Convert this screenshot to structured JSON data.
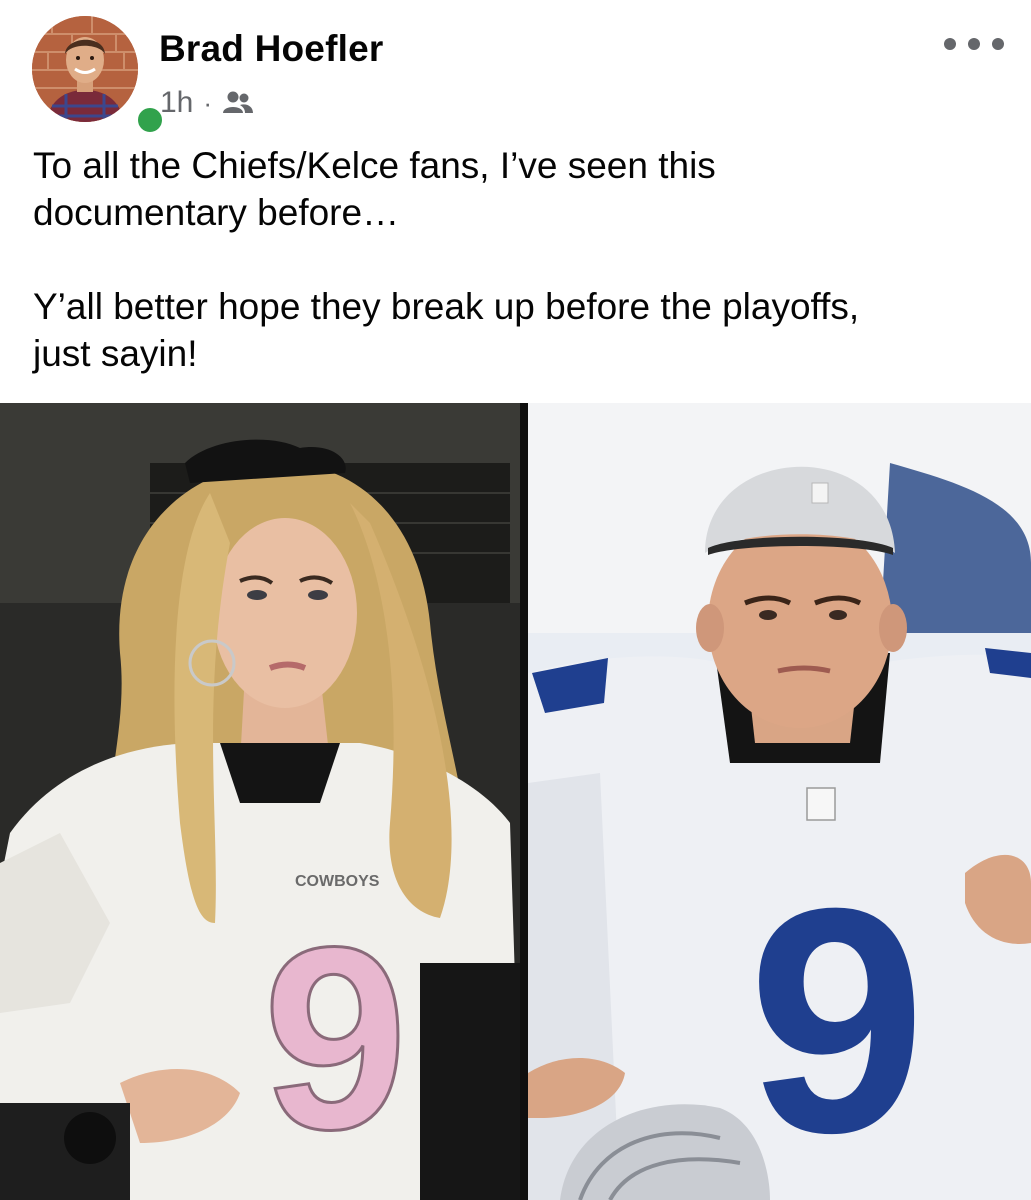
{
  "post": {
    "author": "Brad Hoefler",
    "time": "1h",
    "separator": "·",
    "audience_icon": "friends-icon",
    "online": true,
    "more_icon": "more-horizontal-icon",
    "text_line_1": "To all the Chiefs/Kelce fans, I’ve seen this",
    "text_line_2": "documentary before…",
    "text_line_3": "Y’all better hope they break up before the playoffs,",
    "text_line_4": "just sayin!"
  },
  "photo": {
    "left_jersey_number": "9",
    "right_jersey_number": "9",
    "left_jersey_wordmark": "COWBOYS"
  },
  "colors": {
    "online_green": "#31a24c",
    "secondary_text": "#65676b",
    "primary_text": "#050505",
    "jersey_blue": "#1f3f8f",
    "jersey_pink": "#e8b7cf"
  }
}
